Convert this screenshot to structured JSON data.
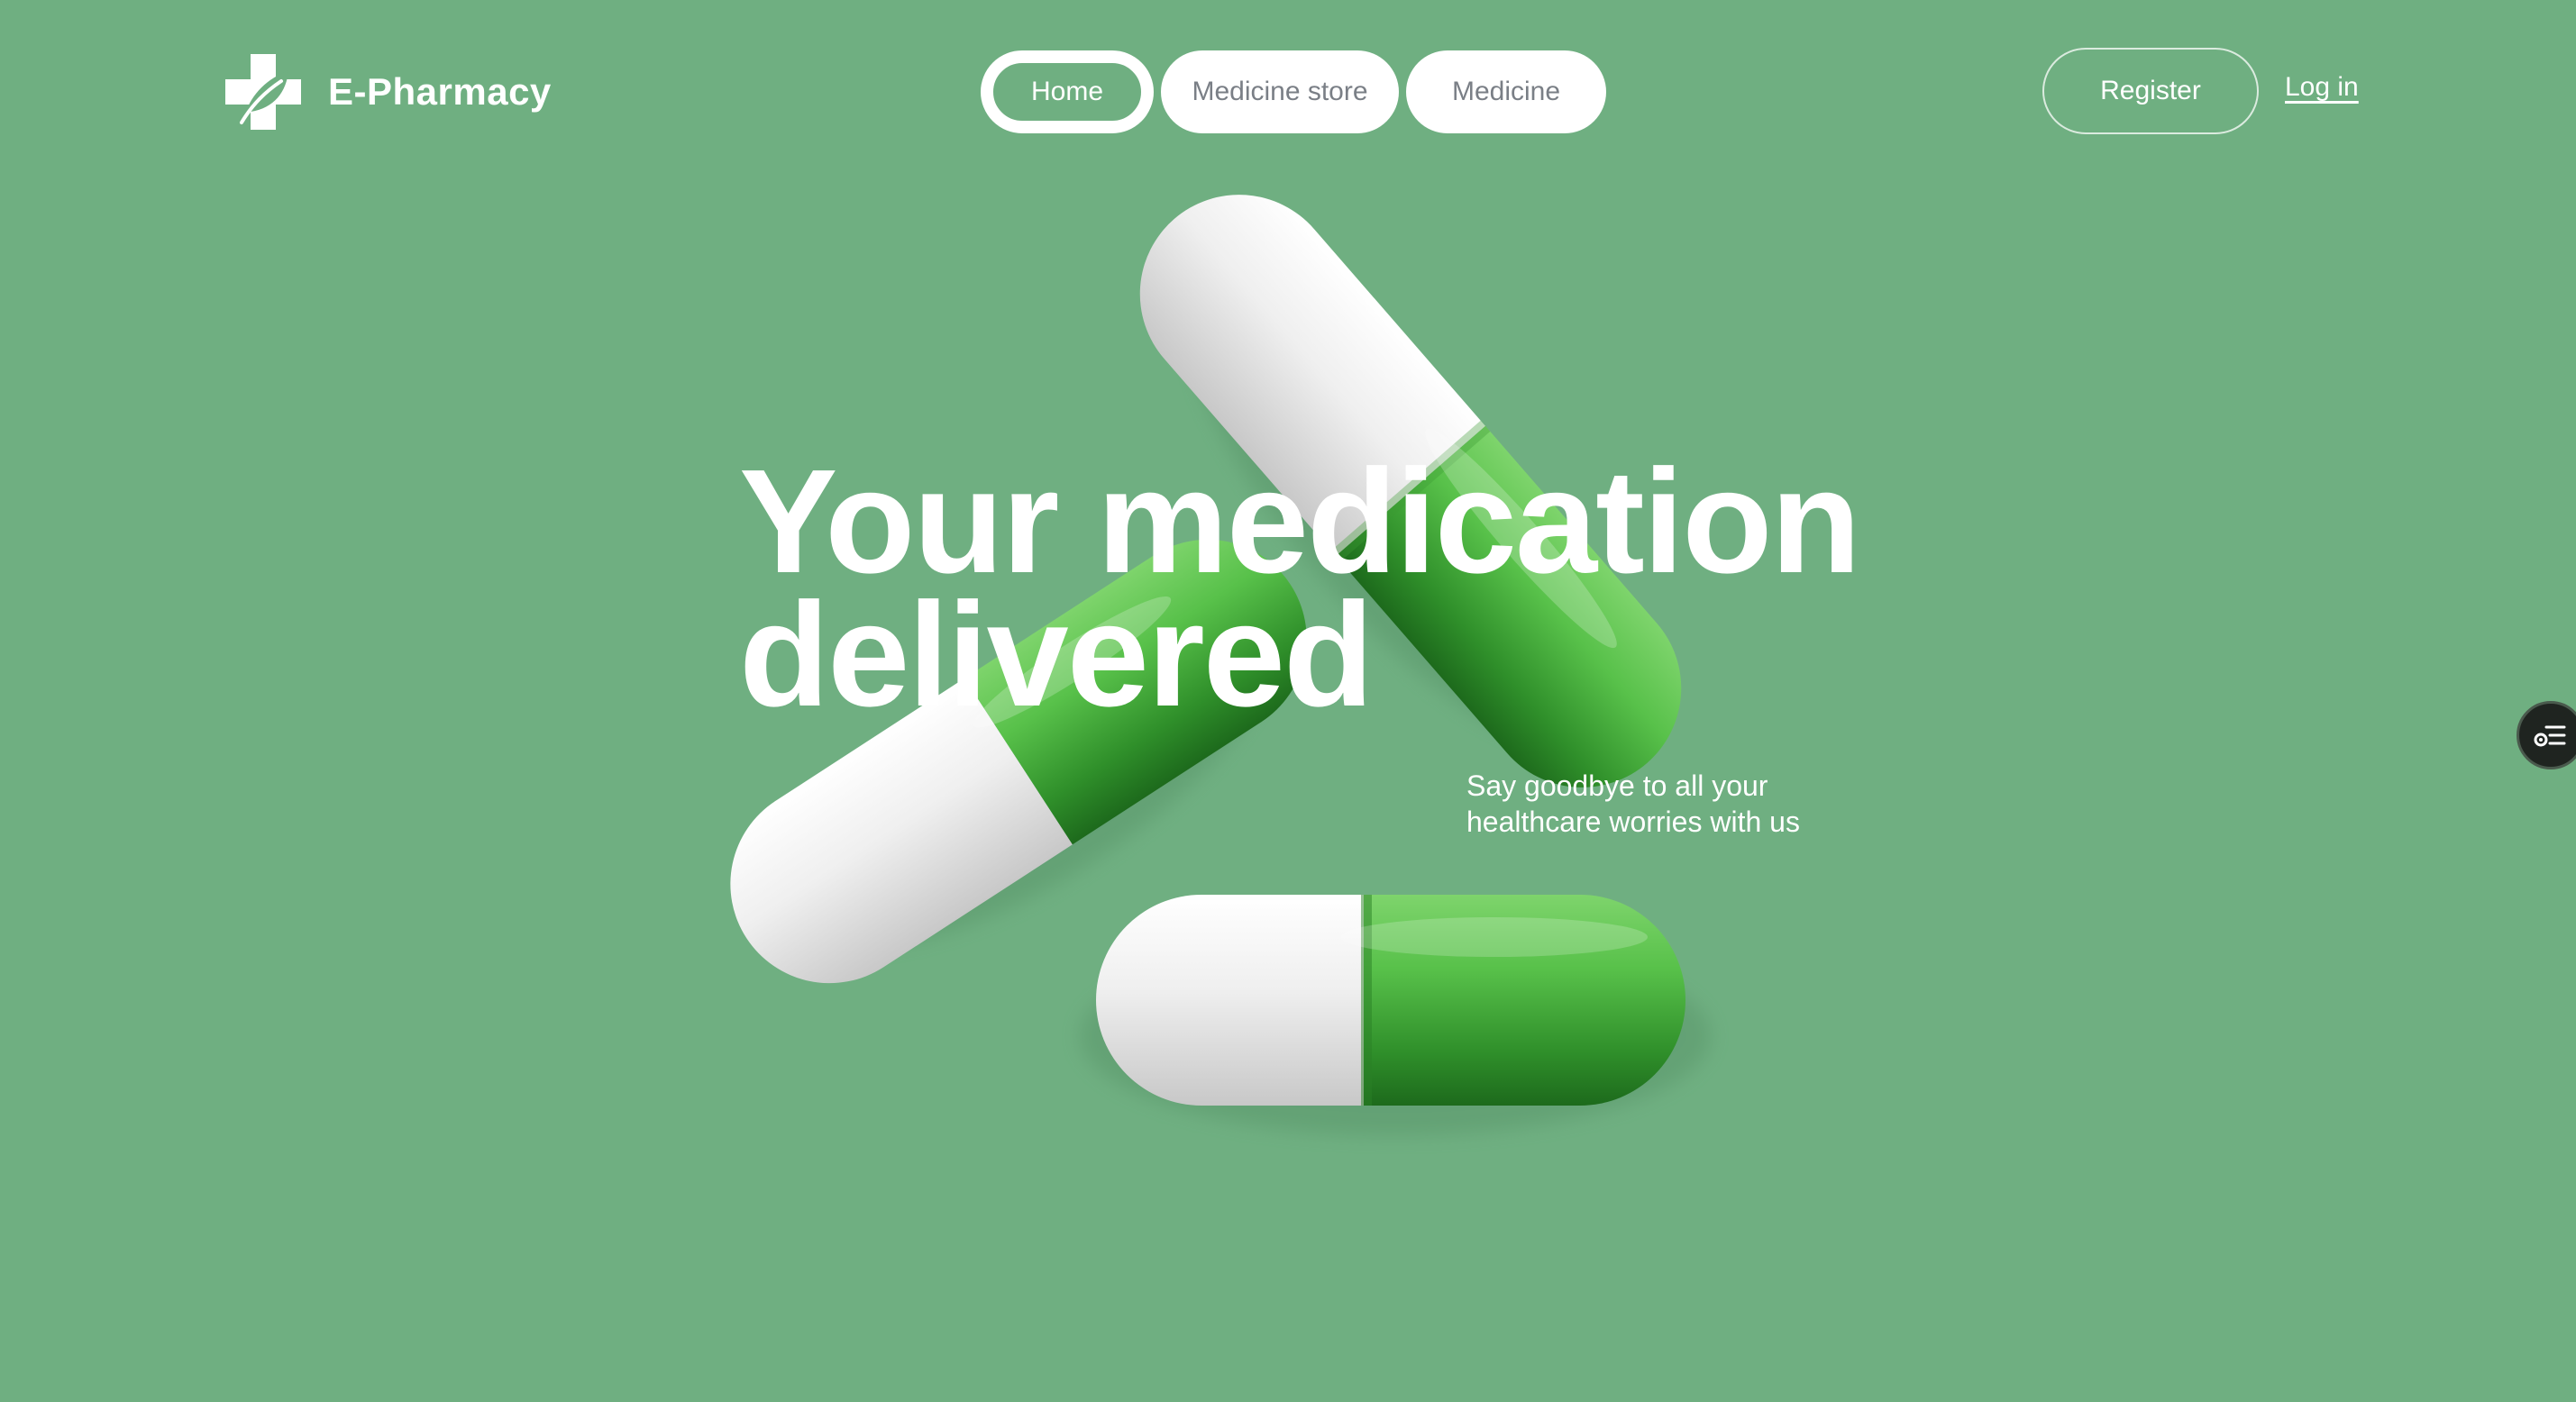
{
  "brand": {
    "name": "E-Pharmacy",
    "icon": "leaf-cross-icon"
  },
  "nav": {
    "items": [
      {
        "label": "Home",
        "active": true
      },
      {
        "label": "Medicine store",
        "active": false
      },
      {
        "label": "Medicine",
        "active": false
      }
    ]
  },
  "auth": {
    "register_label": "Register",
    "login_label": "Log in"
  },
  "hero": {
    "title_line1": "Your medication",
    "title_line2": "delivered",
    "subtitle_line1": "Say goodbye to all your",
    "subtitle_line2": "healthcare worries with us"
  },
  "side_widget": {
    "icon": "checklist-toggle-icon"
  },
  "colors": {
    "background": "#6FAF81",
    "text": "#FFFFFF",
    "pill_green": "#4CB848",
    "pill_white": "#F1F1F1",
    "nav_inactive_text": "#7A7F86"
  }
}
